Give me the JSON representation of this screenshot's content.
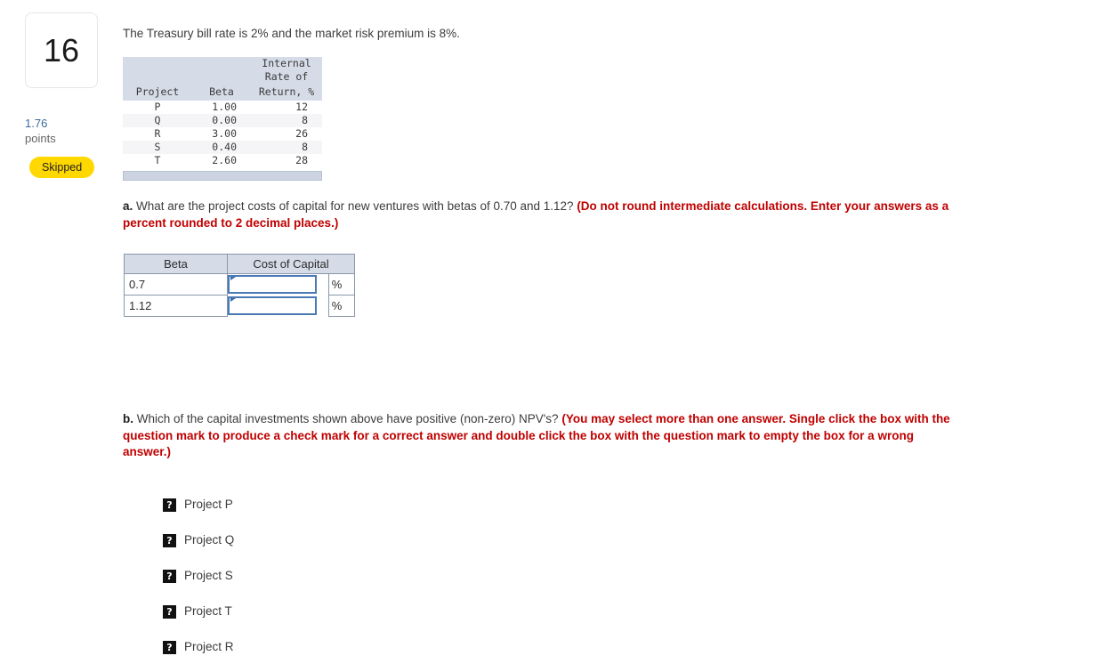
{
  "sidebar": {
    "question_number": "16",
    "points_value": "1.76",
    "points_label": "points",
    "status_badge": "Skipped"
  },
  "main": {
    "intro_text": "The Treasury bill rate is 2% and the market risk premium is 8%.",
    "data_table": {
      "headers": {
        "project": "Project",
        "beta": "Beta",
        "irr_line1": "Internal",
        "irr_line2": "Rate of",
        "irr_line3": "Return, %"
      },
      "rows": [
        {
          "project": "P",
          "beta": "1.00",
          "irr": "12"
        },
        {
          "project": "Q",
          "beta": "0.00",
          "irr": "8"
        },
        {
          "project": "R",
          "beta": "3.00",
          "irr": "26"
        },
        {
          "project": "S",
          "beta": "0.40",
          "irr": "8"
        },
        {
          "project": "T",
          "beta": "2.60",
          "irr": "28"
        }
      ]
    },
    "question_a": {
      "label": "a.",
      "body": " What are the project costs of capital for new ventures with betas of 0.70 and 1.12? ",
      "instruction": "(Do not round intermediate calculations. Enter your answers as a percent rounded to 2 decimal places.)"
    },
    "answer_table": {
      "header_beta": "Beta",
      "header_cost_of_capital": "Cost of Capital",
      "percent_symbol": "%",
      "rows": [
        {
          "beta": "0.7",
          "value": "",
          "placeholder": ""
        },
        {
          "beta": "1.12",
          "value": "",
          "placeholder": ""
        }
      ]
    },
    "question_b": {
      "label": "b.",
      "body": " Which of the capital investments shown above have positive (non-zero) NPV's? ",
      "instruction": "(You may select more than one answer. Single click the box with the question mark to produce a check mark for a correct answer and double click the box with the question mark to empty the box for a wrong answer.)"
    },
    "options": [
      {
        "mark": "?",
        "label": "Project P"
      },
      {
        "mark": "?",
        "label": "Project Q"
      },
      {
        "mark": "?",
        "label": "Project S"
      },
      {
        "mark": "?",
        "label": "Project T"
      },
      {
        "mark": "?",
        "label": "Project R"
      }
    ]
  },
  "colors": {
    "badge_yellow": "#ffd800",
    "instruction_red": "#c00000",
    "table_header_blue_gray": "#d5dce8",
    "input_border_blue": "#4a7ab5",
    "points_blue": "#3b6b9c"
  }
}
